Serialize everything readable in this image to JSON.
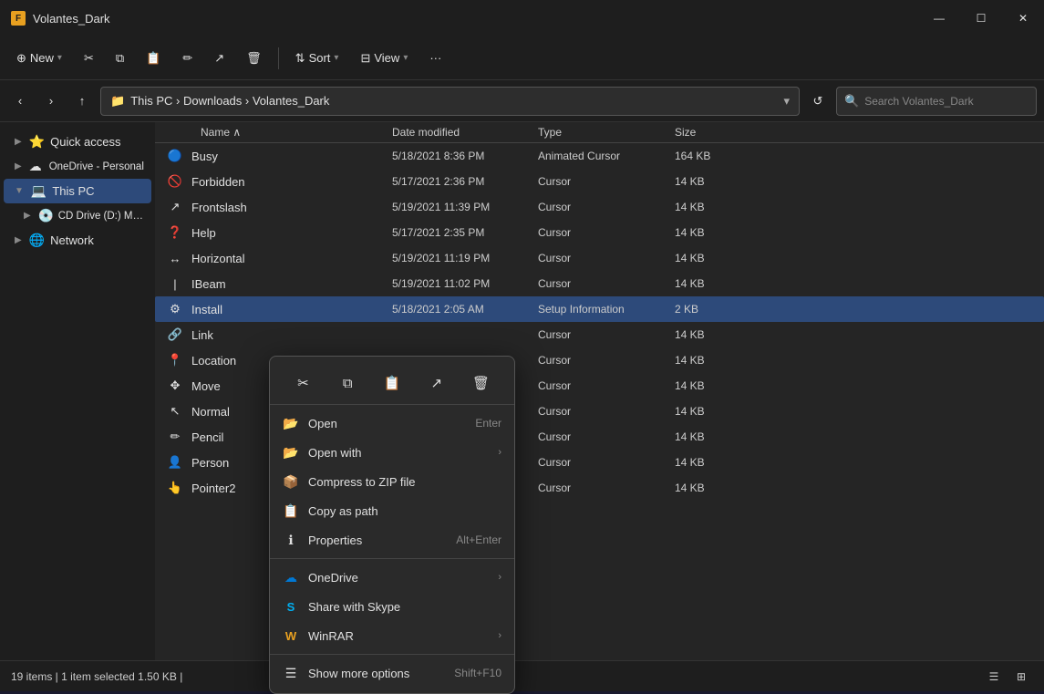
{
  "titleBar": {
    "title": "Volantes_Dark",
    "minBtn": "—",
    "maxBtn": "☐",
    "closeBtn": "✕"
  },
  "toolbar": {
    "newLabel": "New",
    "sortLabel": "Sort",
    "viewLabel": "View",
    "moreLabel": "···"
  },
  "addressBar": {
    "breadcrumb": "This PC  ›  Downloads  ›  Volantes_Dark",
    "searchPlaceholder": "Search Volantes_Dark"
  },
  "sidebar": {
    "items": [
      {
        "id": "quick-access",
        "label": "Quick access",
        "icon": "⭐",
        "expanded": true
      },
      {
        "id": "onedrive",
        "label": "OneDrive - Personal",
        "icon": "☁",
        "expanded": false
      },
      {
        "id": "this-pc",
        "label": "This PC",
        "icon": "💻",
        "expanded": true,
        "active": true
      },
      {
        "id": "cd-drive",
        "label": "CD Drive (D:) Mobile...",
        "icon": "💿",
        "expanded": false
      },
      {
        "id": "network",
        "label": "Network",
        "icon": "🌐",
        "expanded": false
      }
    ]
  },
  "fileList": {
    "columns": [
      "Name",
      "Date modified",
      "Type",
      "Size"
    ],
    "rows": [
      {
        "name": "Busy",
        "icon": "🔵",
        "date": "5/18/2021 8:36 PM",
        "type": "Animated Cursor",
        "size": "164 KB"
      },
      {
        "name": "Forbidden",
        "icon": "🚫",
        "date": "5/17/2021 2:36 PM",
        "type": "Cursor",
        "size": "14 KB"
      },
      {
        "name": "Frontslash",
        "icon": "↗",
        "date": "5/19/2021 11:39 PM",
        "type": "Cursor",
        "size": "14 KB"
      },
      {
        "name": "Help",
        "icon": "❓",
        "date": "5/17/2021 2:35 PM",
        "type": "Cursor",
        "size": "14 KB"
      },
      {
        "name": "Horizontal",
        "icon": "↔",
        "date": "5/19/2021 11:19 PM",
        "type": "Cursor",
        "size": "14 KB"
      },
      {
        "name": "IBeam",
        "icon": "📝",
        "date": "5/19/2021 11:02 PM",
        "type": "Cursor",
        "size": "14 KB"
      },
      {
        "name": "Install",
        "icon": "⚙",
        "date": "5/18/2021 2:05 AM",
        "type": "Setup Information",
        "size": "2 KB",
        "selected": true
      },
      {
        "name": "Link",
        "icon": "🔗",
        "date": "",
        "type": "Cursor",
        "size": "14 KB"
      },
      {
        "name": "Location",
        "icon": "📍",
        "date": "",
        "type": "Cursor",
        "size": "14 KB"
      },
      {
        "name": "Move",
        "icon": "✥",
        "date": "",
        "type": "Cursor",
        "size": "14 KB"
      },
      {
        "name": "Normal",
        "icon": "↖",
        "date": "",
        "type": "Cursor",
        "size": "14 KB"
      },
      {
        "name": "Pencil",
        "icon": "✏",
        "date": "",
        "type": "Cursor",
        "size": "14 KB"
      },
      {
        "name": "Person",
        "icon": "👤",
        "date": "",
        "type": "Cursor",
        "size": "14 KB"
      },
      {
        "name": "Pointer2",
        "icon": "👆",
        "date": "",
        "type": "Cursor",
        "size": "14 KB"
      }
    ]
  },
  "contextMenu": {
    "iconBar": [
      {
        "id": "cut-icon",
        "icon": "✂",
        "label": "Cut"
      },
      {
        "id": "copy-icon",
        "icon": "⧉",
        "label": "Copy"
      },
      {
        "id": "paste-icon",
        "icon": "📋",
        "label": "Paste"
      },
      {
        "id": "share-icon",
        "icon": "↗",
        "label": "Share"
      },
      {
        "id": "delete-icon",
        "icon": "🗑",
        "label": "Delete"
      }
    ],
    "items": [
      {
        "id": "open",
        "icon": "📂",
        "label": "Open",
        "shortcut": "Enter",
        "arrow": false
      },
      {
        "id": "open-with",
        "icon": "📂",
        "label": "Open with",
        "shortcut": "",
        "arrow": true
      },
      {
        "id": "compress-zip",
        "icon": "📦",
        "label": "Compress to ZIP file",
        "shortcut": "",
        "arrow": false
      },
      {
        "id": "copy-path",
        "icon": "📋",
        "label": "Copy as path",
        "shortcut": "",
        "arrow": false
      },
      {
        "id": "properties",
        "icon": "ℹ",
        "label": "Properties",
        "shortcut": "Alt+Enter",
        "arrow": false
      },
      {
        "id": "sep1",
        "separator": true
      },
      {
        "id": "onedrive",
        "icon": "☁",
        "label": "OneDrive",
        "shortcut": "",
        "arrow": true
      },
      {
        "id": "skype",
        "icon": "S",
        "label": "Share with Skype",
        "shortcut": "",
        "arrow": false
      },
      {
        "id": "winrar",
        "icon": "W",
        "label": "WinRAR",
        "shortcut": "",
        "arrow": true
      },
      {
        "id": "sep2",
        "separator": true
      },
      {
        "id": "more-options",
        "icon": "☰",
        "label": "Show more options",
        "shortcut": "Shift+F10",
        "arrow": false
      }
    ]
  },
  "statusBar": {
    "text": "19 items  |  1 item selected  1.50 KB  |"
  }
}
